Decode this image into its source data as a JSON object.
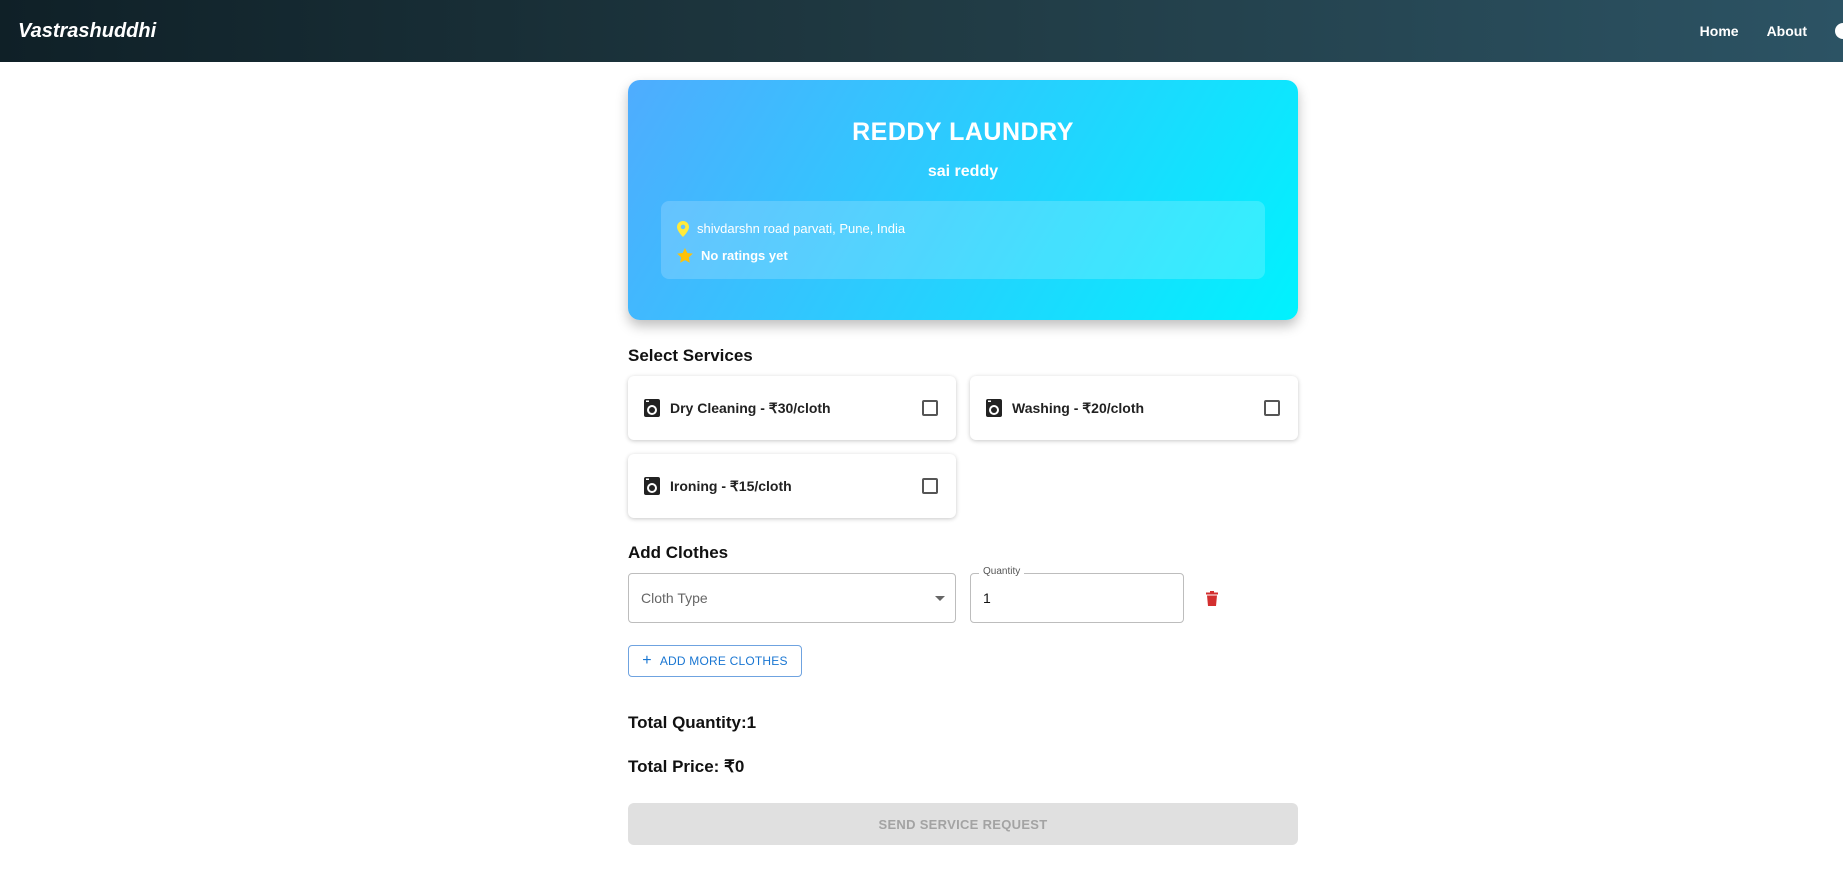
{
  "navbar": {
    "brand": "Vastrashuddhi",
    "links": [
      "Home",
      "About"
    ]
  },
  "shop": {
    "name": "REDDY LAUNDRY",
    "owner": "sai reddy",
    "address": "shivdarshn road parvati, Pune, India",
    "rating": "No ratings yet"
  },
  "services": {
    "title": "Select Services",
    "items": [
      {
        "label": "Dry Cleaning - ₹30/cloth",
        "checked": false
      },
      {
        "label": "Washing - ₹20/cloth",
        "checked": false
      },
      {
        "label": "Ironing - ₹15/cloth",
        "checked": false
      }
    ]
  },
  "clothes": {
    "title": "Add Clothes",
    "cloth_type_placeholder": "Cloth Type",
    "quantity_label": "Quantity",
    "quantity_value": "1",
    "add_more_label": "ADD MORE CLOTHES"
  },
  "totals": {
    "quantity_text": "Total Quantity:1",
    "price_text": "Total Price: ₹0"
  },
  "submit_label": "SEND SERVICE REQUEST",
  "colors": {
    "nav_gradient_start": "#0f2027",
    "nav_gradient_end": "#2c5364",
    "card_gradient_start": "#4facfe",
    "card_gradient_end": "#00f2fe",
    "pin_icon": "#ffeb3b",
    "star_icon": "#ffc107",
    "delete_icon": "#d32f2f",
    "primary_button": "#1976d2"
  }
}
